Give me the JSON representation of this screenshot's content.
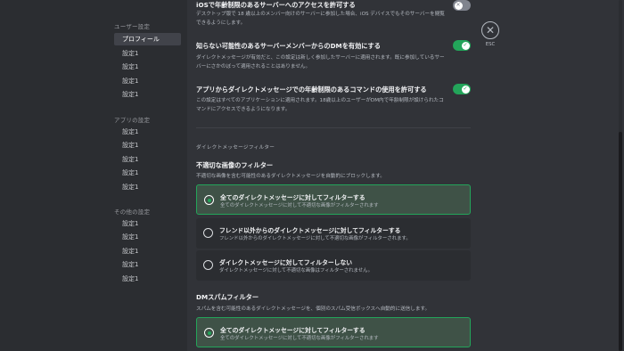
{
  "sidebar": {
    "sections": [
      {
        "heading": "ユーザー設定",
        "items": [
          "プロフィール",
          "設定1",
          "設定1",
          "設定1",
          "設定1",
          "設定1"
        ]
      },
      {
        "heading": "アプリの設定",
        "items": [
          "設定1",
          "設定1",
          "設定1",
          "設定1",
          "設定1"
        ]
      },
      {
        "heading": "その他の設定",
        "items": [
          "設定1",
          "設定1",
          "設定1",
          "設定1",
          "設定1"
        ]
      }
    ]
  },
  "settings": [
    {
      "title": "iOSで年齢制限のあるサーバーへのアクセスを許可する",
      "desc": "デスクトップ版で 18 歳以上のメンバー向けのサーバーに参加した場合、iOS デバイスでもそのサーバーを閲覧できるようにします。",
      "enabled": false
    },
    {
      "title": "知らない可能性のあるサーバーメンバーからのDMを有効にする",
      "desc": "ダイレクトメッセージが有効だと、この設定は新しく参加したサーバーに適用されます。既に参加しているサーバーにさかのぼって適用されることはありません。",
      "enabled": true
    },
    {
      "title": "アプリからダイレクトメッセージでの年齢制限のあるコマンドの使用を許可する",
      "desc": "この設定はすべてのアプリケーションに適用されます。18歳以上のユーザーがDM内で年齢制限が設けられたコマンドにアクセスできるようになります。",
      "enabled": true
    }
  ],
  "dm_filter": {
    "section_label": "ダイレクトメッセージフィルター",
    "title": "不適切な画像のフィルター",
    "desc": "不適切な画像を含む可能性のあるダイレクトメッセージを自動的にブロックします。",
    "options": [
      {
        "title": "全てのダイレクトメッセージに対してフィルターする",
        "desc": "全てのダイレクトメッセージに対して不適切な画像がフィルターされます",
        "selected": true
      },
      {
        "title": "フレンド以外からのダイレクトメッセージに対してフィルターする",
        "desc": "フレンド以外からのダイレクトメッセージに対して不適切な画像がフィルターされます。",
        "selected": false
      },
      {
        "title": "ダイレクトメッセージに対してフィルターしない",
        "desc": "ダイレクトメッセージに対して不適切な画像はフィルターされません。",
        "selected": false
      }
    ]
  },
  "spam_filter": {
    "title": "DMスパムフィルター",
    "desc": "スパムを含む可能性のあるダイレクトメッセージを、個別のスパム受信ボックスへ自動的に送信します。",
    "options": [
      {
        "title": "全てのダイレクトメッセージに対してフィルターする",
        "desc": "全てのダイレクトメッセージに対して不適切な画像がフィルターされます",
        "selected": true
      }
    ]
  },
  "close": {
    "icon": "close-icon",
    "label": "ESC"
  },
  "colors": {
    "accent": "#23a55a",
    "background": "#313338",
    "sidebar": "#2b2d31"
  }
}
